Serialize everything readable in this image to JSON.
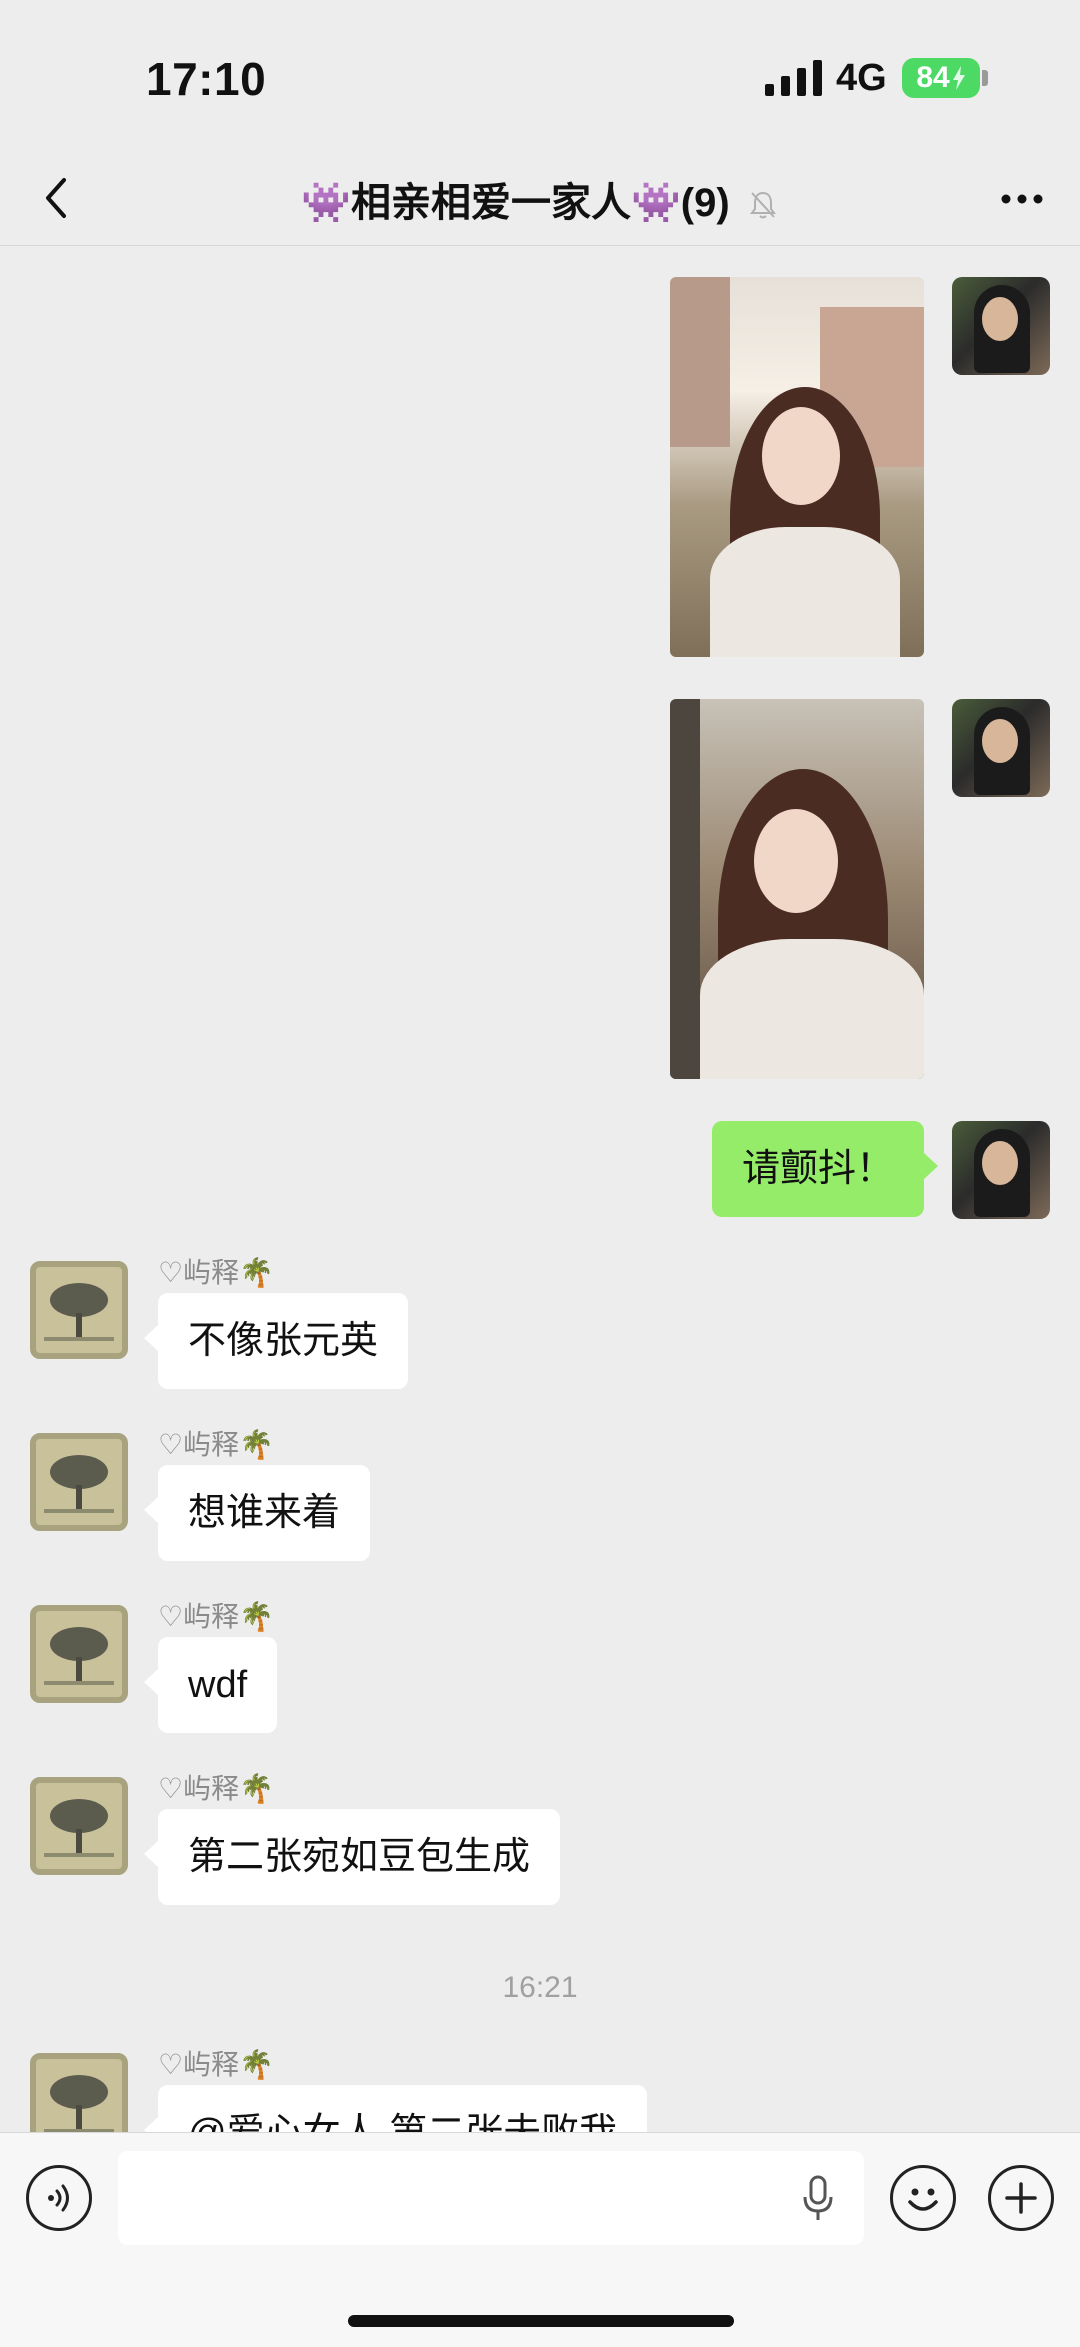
{
  "status_bar": {
    "time": "17:10",
    "network": "4G",
    "battery": "84"
  },
  "header": {
    "title": "👾相亲相爱一家人👾(9)",
    "back_icon": "chevron-left-icon",
    "mute_icon": "bell-slash-icon",
    "more_icon": "ellipsis-icon"
  },
  "messages": {
    "m1": {
      "sender": "me",
      "type": "image"
    },
    "m2": {
      "sender": "me",
      "type": "image"
    },
    "m3": {
      "sender": "me",
      "text": "请颤抖！"
    },
    "m4": {
      "name": "♡屿释🌴",
      "text": "不像张元英"
    },
    "m5": {
      "name": "♡屿释🌴",
      "text": "想谁来着"
    },
    "m6": {
      "name": "♡屿释🌴",
      "text": "wdf"
    },
    "m7": {
      "name": "♡屿释🌴",
      "text": "第二张宛如豆包生成"
    },
    "timestamp": "16:21",
    "m8": {
      "name": "♡屿释🌴",
      "text": "@爱心女人 第二张未败我"
    }
  },
  "input_bar": {
    "voice_icon": "voice-icon",
    "input_value": "",
    "mic_icon": "microphone-icon",
    "emoji_icon": "emoji-icon",
    "plus_icon": "plus-icon"
  },
  "colors": {
    "background": "#ededed",
    "my_bubble": "#95ec69",
    "other_bubble": "#ffffff",
    "battery": "#4cd964"
  }
}
